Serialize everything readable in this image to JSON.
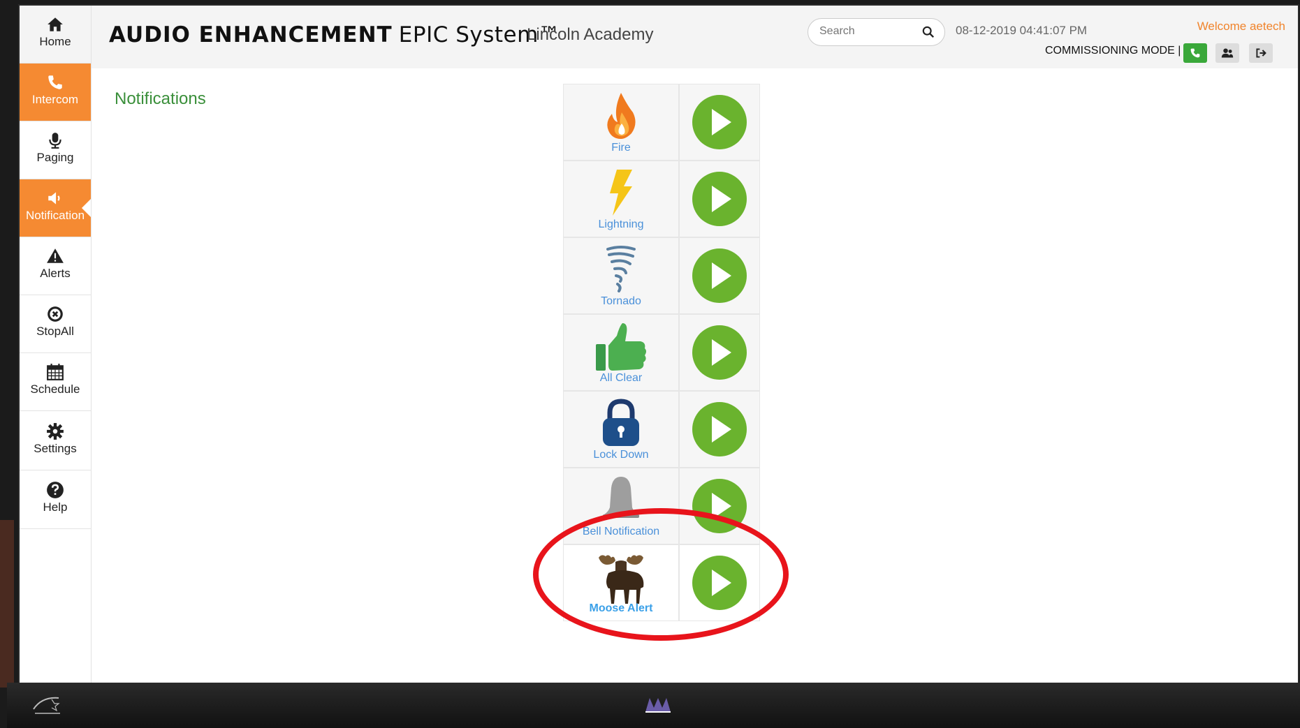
{
  "header": {
    "brand": "AUDIO ENHANCEMENT",
    "product": "EPIC System™",
    "school": "Lincoln Academy",
    "search_placeholder": "Search",
    "datetime": "08-12-2019 04:41:07 PM",
    "welcome": "Welcome aetech",
    "mode": "COMMISSIONING MODE |"
  },
  "sidebar": {
    "items": [
      {
        "label": "Home"
      },
      {
        "label": "Intercom"
      },
      {
        "label": "Paging"
      },
      {
        "label": "Notification"
      },
      {
        "label": "Alerts"
      },
      {
        "label": "StopAll"
      },
      {
        "label": "Schedule"
      },
      {
        "label": "Settings"
      },
      {
        "label": "Help"
      }
    ]
  },
  "main": {
    "title": "Notifications",
    "notifications": [
      {
        "label": "Fire",
        "icon": "fire-icon"
      },
      {
        "label": "Lightning",
        "icon": "lightning-icon"
      },
      {
        "label": "Tornado",
        "icon": "tornado-icon"
      },
      {
        "label": "All Clear",
        "icon": "thumbs-up-icon"
      },
      {
        "label": "Lock Down",
        "icon": "lock-icon"
      },
      {
        "label": "Bell Notification",
        "icon": "bell-icon"
      },
      {
        "label": "Moose Alert",
        "icon": "moose-icon"
      }
    ]
  },
  "colors": {
    "accent_orange": "#f58a32",
    "title_green": "#3a8f3a",
    "play_green": "#6ab32e",
    "highlight_red": "#e8141b"
  }
}
